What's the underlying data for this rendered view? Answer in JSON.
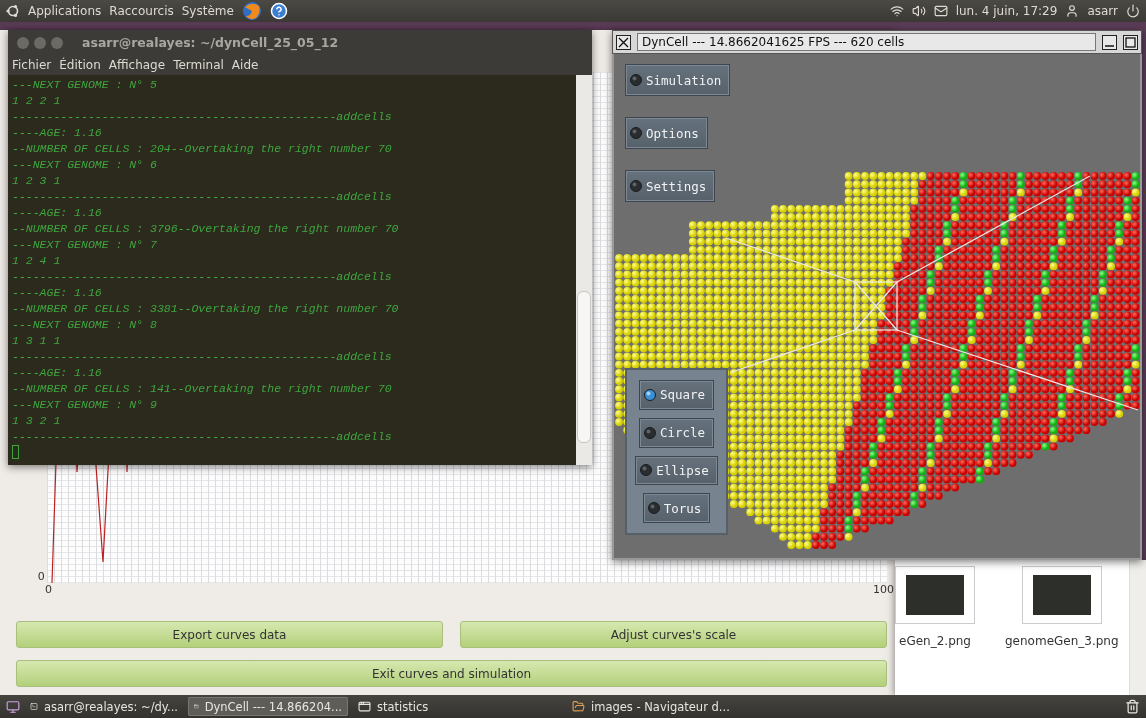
{
  "top_panel": {
    "menus": [
      "Applications",
      "Raccourcis",
      "Système"
    ],
    "clock": "lun. 4 juin, 17:29",
    "user": "asarr"
  },
  "statistics_window": {
    "y_axis_label": "0",
    "x_axis_labels": [
      "0",
      "100"
    ],
    "buttons": [
      {
        "label": "Export curves data",
        "kind": "half"
      },
      {
        "label": "Adjust curves's scale",
        "kind": "half"
      },
      {
        "label": "Exit curves and simulation",
        "kind": "full"
      }
    ]
  },
  "file_browser": {
    "files": [
      "eGen_2.png",
      "genomeGen_3.png"
    ]
  },
  "terminal": {
    "title": "asarr@realayes: ~/dynCell_25_05_12",
    "menu": [
      "Fichier",
      "Édition",
      "Affichage",
      "Terminal",
      "Aide"
    ],
    "lines": [
      "---NEXT GENOME : N° 5",
      "1 2 2 1",
      "-----------------------------------------------addcells",
      "----AGE: 1.16",
      "--NUMBER OF CELLS : 204--Overtaking the right number 70",
      "---NEXT GENOME : N° 6",
      "1 2 3 1",
      "-----------------------------------------------addcells",
      "----AGE: 1.16",
      "--NUMBER OF CELLS : 3796--Overtaking the right number 70",
      "---NEXT GENOME : N° 7",
      "1 2 4 1",
      "-----------------------------------------------addcells",
      "----AGE: 1.16",
      "--NUMBER OF CELLS : 3381--Overtaking the right number 70",
      "---NEXT GENOME : N° 8",
      "1 3 1 1",
      "-----------------------------------------------addcells",
      "----AGE: 1.16",
      "--NUMBER OF CELLS : 141--Overtaking the right number 70",
      "---NEXT GENOME : N° 9",
      "1 3 2 1",
      "-----------------------------------------------addcells"
    ]
  },
  "dyncell": {
    "title": "DynCell --- 14.8662041625 FPS --- 620 cells",
    "buttons": [
      "Simulation",
      "Options",
      "Settings"
    ],
    "shapes": [
      {
        "label": "Square",
        "selected": true
      },
      {
        "label": "Circle",
        "selected": false
      },
      {
        "label": "Ellipse",
        "selected": false
      },
      {
        "label": "Torus",
        "selected": false
      }
    ]
  },
  "taskbar": {
    "tasks": [
      {
        "label": "asarr@realayes: ~/dy...",
        "kind": "terminal",
        "selected": false
      },
      {
        "label": "DynCell --- 14.866204...",
        "kind": "window",
        "selected": true
      },
      {
        "label": "statistics",
        "kind": "window",
        "selected": false
      },
      {
        "label": "images - Navigateur d...",
        "kind": "folder",
        "selected": false
      }
    ]
  }
}
